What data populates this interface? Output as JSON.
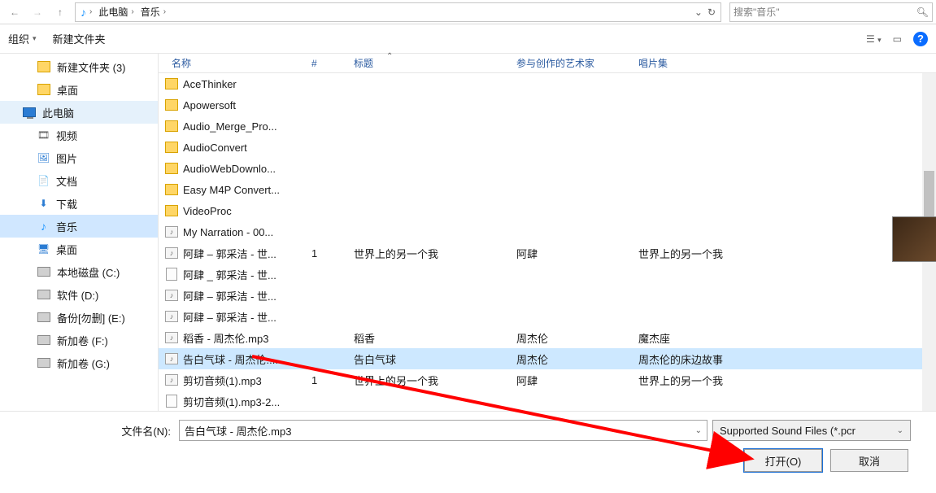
{
  "breadcrumb": {
    "root_chev": "›",
    "seg1": "此电脑",
    "seg2": "音乐"
  },
  "search": {
    "placeholder": "搜索\"音乐\""
  },
  "toolbar": {
    "organize": "组织",
    "new_folder": "新建文件夹"
  },
  "sidebar": {
    "items": [
      {
        "label": "新建文件夹 (3)",
        "icon": "folder",
        "level": 2
      },
      {
        "label": "桌面",
        "icon": "folder",
        "level": 2
      },
      {
        "label": "此电脑",
        "icon": "monitor",
        "level": 1,
        "hl": true
      },
      {
        "label": "视频",
        "icon": "video",
        "level": 2
      },
      {
        "label": "图片",
        "icon": "image",
        "level": 2
      },
      {
        "label": "文档",
        "icon": "doc",
        "level": 2
      },
      {
        "label": "下载",
        "icon": "download",
        "level": 2
      },
      {
        "label": "音乐",
        "icon": "music",
        "level": 2,
        "sel": true
      },
      {
        "label": "桌面",
        "icon": "desktop",
        "level": 2
      },
      {
        "label": "本地磁盘 (C:)",
        "icon": "disk",
        "level": 2
      },
      {
        "label": "软件 (D:)",
        "icon": "disk",
        "level": 2
      },
      {
        "label": "备份[勿删] (E:)",
        "icon": "disk",
        "level": 2
      },
      {
        "label": "新加卷 (F:)",
        "icon": "disk",
        "level": 2
      },
      {
        "label": "新加卷 (G:)",
        "icon": "disk",
        "level": 2
      }
    ]
  },
  "columns": {
    "name": "名称",
    "number": "#",
    "title": "标题",
    "artist": "参与创作的艺术家",
    "album": "唱片集"
  },
  "rows": [
    {
      "icon": "folder",
      "name": "AceThinker"
    },
    {
      "icon": "folder",
      "name": "Apowersoft"
    },
    {
      "icon": "folder",
      "name": "Audio_Merge_Pro..."
    },
    {
      "icon": "folder",
      "name": "AudioConvert"
    },
    {
      "icon": "folder",
      "name": "AudioWebDownlo..."
    },
    {
      "icon": "folder",
      "name": "Easy M4P Convert..."
    },
    {
      "icon": "folder",
      "name": "VideoProc"
    },
    {
      "icon": "audio",
      "name": "My Narration - 00..."
    },
    {
      "icon": "audio",
      "name": "阿肆 – 郭采洁 - 世...",
      "num": "1",
      "title": "世界上的另一个我",
      "artist": "阿肆",
      "album": "世界上的另一个我"
    },
    {
      "icon": "file",
      "name": "阿肆 _ 郭采洁 - 世..."
    },
    {
      "icon": "audio",
      "name": "阿肆 – 郭采洁 - 世..."
    },
    {
      "icon": "audio",
      "name": "阿肆 – 郭采洁 - 世..."
    },
    {
      "icon": "audio",
      "name": "稻香 - 周杰伦.mp3",
      "title": "稻香",
      "artist": "周杰伦",
      "album": "魔杰座"
    },
    {
      "icon": "audio",
      "name": "告白气球 - 周杰伦....",
      "title": "告白气球",
      "artist": "周杰伦",
      "album": "周杰伦的床边故事",
      "selected": true
    },
    {
      "icon": "audio",
      "name": "剪切音频(1).mp3",
      "num": "1",
      "title": "世界上的另一个我",
      "artist": "阿肆",
      "album": "世界上的另一个我"
    },
    {
      "icon": "file",
      "name": "剪切音频(1).mp3-2..."
    }
  ],
  "filename_label": "文件名(N):",
  "filename_value": "告白气球 - 周杰伦.mp3",
  "type_filter": "Supported Sound Files (*.pcr",
  "buttons": {
    "open": "打开(O)",
    "cancel": "取消"
  }
}
